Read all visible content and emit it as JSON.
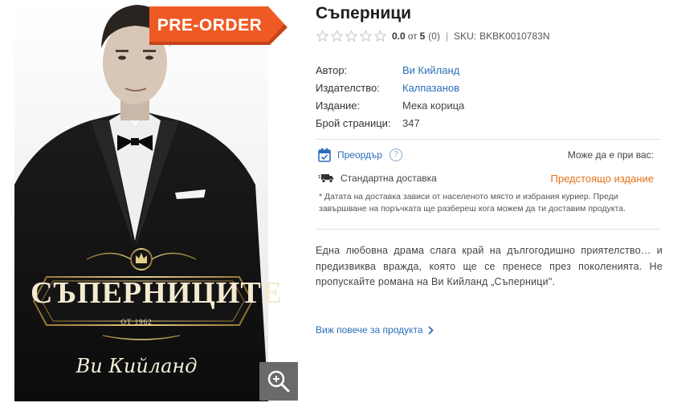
{
  "cover": {
    "badge": "PRE-ORDER",
    "title_art": "СЪПЕРНИЦИТЕ",
    "subtitle_art": "ОТ 1962",
    "author_art": "Ви Кийланд",
    "zoom_icon": "zoom-in-icon"
  },
  "product": {
    "title": "Съперници",
    "rating": {
      "value": "0.0",
      "of_text": "от",
      "max": "5",
      "count": "(0)",
      "stars_filled": 0,
      "stars_total": 5
    },
    "sku_label": "SKU:",
    "sku": "BKBK0010783N",
    "specs": [
      {
        "key": "Автор:",
        "value": "Ви Кийланд",
        "link": true
      },
      {
        "key": "Издателство:",
        "value": "Калпазанов",
        "link": true
      },
      {
        "key": "Издание:",
        "value": "Мека корица",
        "link": false
      },
      {
        "key": "Брой страници:",
        "value": "347",
        "link": false
      }
    ]
  },
  "availability": {
    "preorder_label": "Преордър",
    "help_glyph": "?",
    "may_be_text": "Може да е при вас:",
    "delivery_label": "Стандартна доставка",
    "status": "Предстоящо издание",
    "note": "* Датата на доставка зависи от населеното място и избрания куриер. Преди завършване на поръчката ще разбереш кога можем да ти доставим продукта."
  },
  "description": "Една любовна драма слага край на дългогодишно приятелство… и предизвиква вражда, която ще се пренесе през поколенията. Не пропускайте романа на Ви Кийланд „Съперници\".",
  "more_link": "Виж повече за продукта",
  "colors": {
    "link": "#2a6ebb",
    "status": "#e2701a",
    "badge": "#ef5a24",
    "star": "#c9c9c9"
  }
}
